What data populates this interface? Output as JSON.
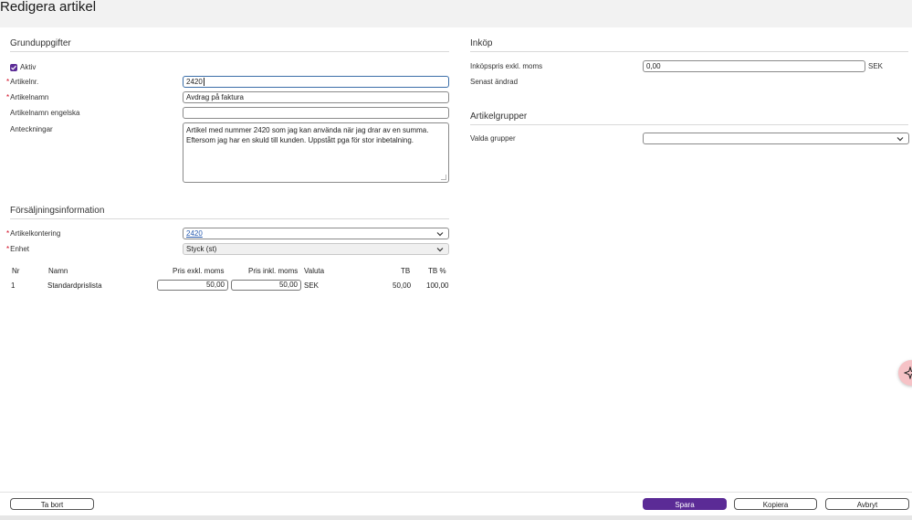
{
  "page": {
    "title": "Redigera artikel"
  },
  "grund": {
    "title": "Grunduppgifter",
    "aktiv_label": "Aktiv",
    "aktiv_checked": true,
    "artikelnr_label": "Artikelnr.",
    "artikelnr_value": "2420",
    "artikelnamn_label": "Artikelnamn",
    "artikelnamn_value": "Avdrag på faktura",
    "engelska_label": "Artikelnamn engelska",
    "engelska_value": "",
    "anteckningar_label": "Anteckningar",
    "anteckningar_value": "Artikel med nummer 2420 som jag kan använda när jag drar av en summa. Eftersom jag har en skuld till kunden. Uppstått pga för stor inbetalning."
  },
  "forsaljning": {
    "title": "Försäljningsinformation",
    "kontering_label": "Artikelkontering",
    "kontering_value": "2420",
    "enhet_label": "Enhet",
    "enhet_value": "Styck (st)"
  },
  "pricelist": {
    "headers": {
      "nr": "Nr",
      "namn": "Namn",
      "exkl": "Pris exkl. moms",
      "inkl": "Pris inkl. moms",
      "valuta": "Valuta",
      "tb": "TB",
      "tbp": "TB %"
    },
    "rows": [
      {
        "nr": "1",
        "namn": "Standardprislista",
        "exkl": "50,00",
        "inkl": "50,00",
        "valuta": "SEK",
        "tb": "50,00",
        "tbp": "100,00"
      }
    ]
  },
  "inkop": {
    "title": "Inköp",
    "pris_label": "Inköpspris exkl. moms",
    "pris_value": "0,00",
    "currency": "SEK",
    "andrad_label": "Senast ändrad"
  },
  "artikelgrupper": {
    "title": "Artikelgrupper",
    "valda_label": "Valda grupper",
    "valda_value": ""
  },
  "footer": {
    "delete_label": "Ta bort",
    "save_label": "Spara",
    "copy_label": "Kopiera",
    "cancel_label": "Avbryt"
  },
  "colors": {
    "primary": "#5b2b96",
    "required": "#d0021b",
    "link": "#2a5db0"
  }
}
